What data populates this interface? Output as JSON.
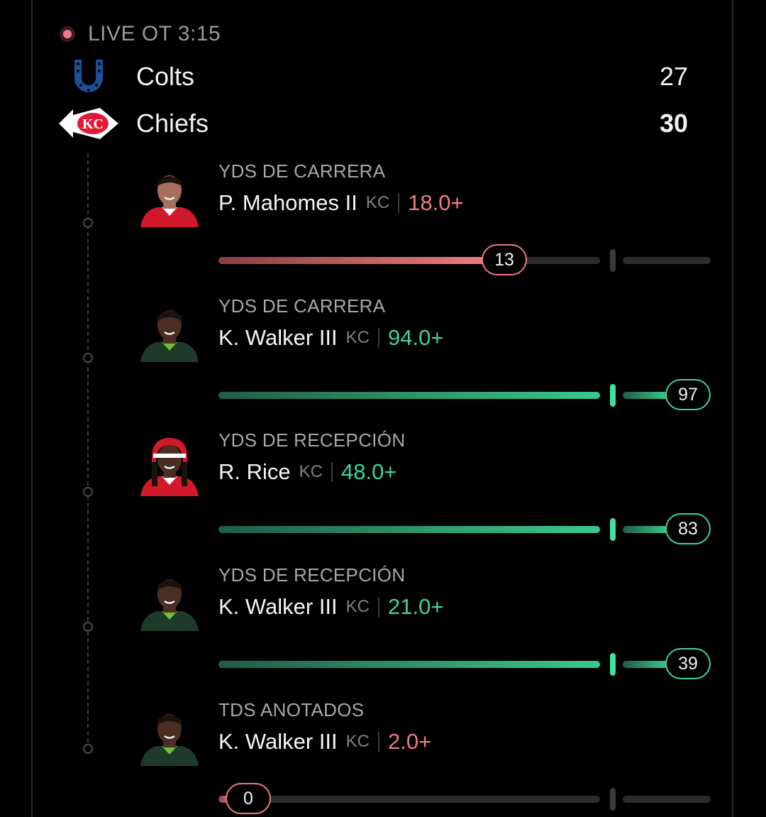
{
  "game": {
    "status": "LIVE OT 3:15",
    "home": {
      "name": "Colts",
      "score": "27"
    },
    "away": {
      "name": "Chiefs",
      "score": "30"
    }
  },
  "colors": {
    "hit": "#3fd39a",
    "miss": "#ee7b82",
    "live": "#ee7b86"
  },
  "props": [
    {
      "stat": "YDS DE CARRERA",
      "player": "P. Mahomes II",
      "team": "KC",
      "target": "18.0+",
      "current": "13",
      "progress": 0.72,
      "status": "miss",
      "avatar": "red-jersey"
    },
    {
      "stat": "YDS DE CARRERA",
      "player": "K. Walker III",
      "team": "KC",
      "target": "94.0+",
      "current": "97",
      "progress": 1.0,
      "status": "hit",
      "avatar": "green-jersey"
    },
    {
      "stat": "YDS DE RECEPCIÓN",
      "player": "R. Rice",
      "team": "KC",
      "target": "48.0+",
      "current": "83",
      "progress": 1.0,
      "status": "hit",
      "avatar": "red-helmet"
    },
    {
      "stat": "YDS DE RECEPCIÓN",
      "player": "K. Walker III",
      "team": "KC",
      "target": "21.0+",
      "current": "39",
      "progress": 1.0,
      "status": "hit",
      "avatar": "green-jersey"
    },
    {
      "stat": "TDS ANOTADOS",
      "player": "K. Walker III",
      "team": "KC",
      "target": "2.0+",
      "current": "0",
      "progress": 0.0,
      "status": "miss",
      "avatar": "green-jersey"
    }
  ]
}
